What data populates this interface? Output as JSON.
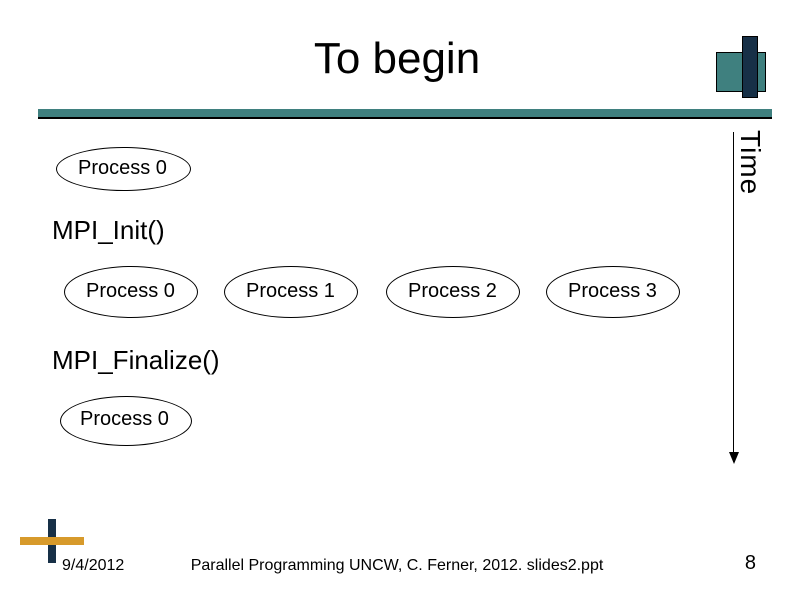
{
  "title": "To begin",
  "time_label": "Time",
  "stages": {
    "init": "MPI_Init()",
    "finalize": "MPI_Finalize()"
  },
  "labels": {
    "p0": "Process 0",
    "p1": "Process 1",
    "p2": "Process 2",
    "p3": "Process 3"
  },
  "footer": {
    "date": "9/4/2012",
    "center": "Parallel Programming  UNCW, C. Ferner, 2012. slides2.ppt",
    "page": "8"
  }
}
